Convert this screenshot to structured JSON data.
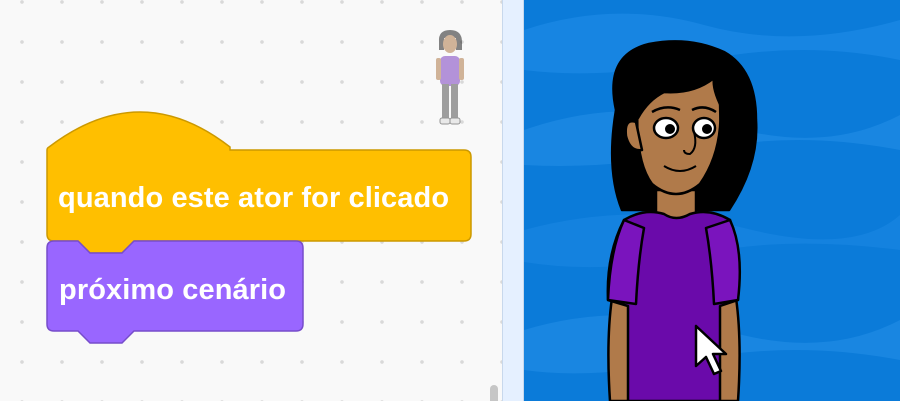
{
  "code_area": {
    "hat_block": {
      "label": "quando este ator for clicado",
      "color": "#FFBF00",
      "border_color": "#CC9900"
    },
    "stack_block": {
      "label": "próximo cenário",
      "color": "#9966FF",
      "border_color": "#774DCB"
    },
    "sprite_thumbnail": "character-sprite"
  },
  "stage": {
    "backdrop_color": "#0B7BD9",
    "sprite": "girl-character",
    "cursor": "mouse-pointer-icon"
  }
}
